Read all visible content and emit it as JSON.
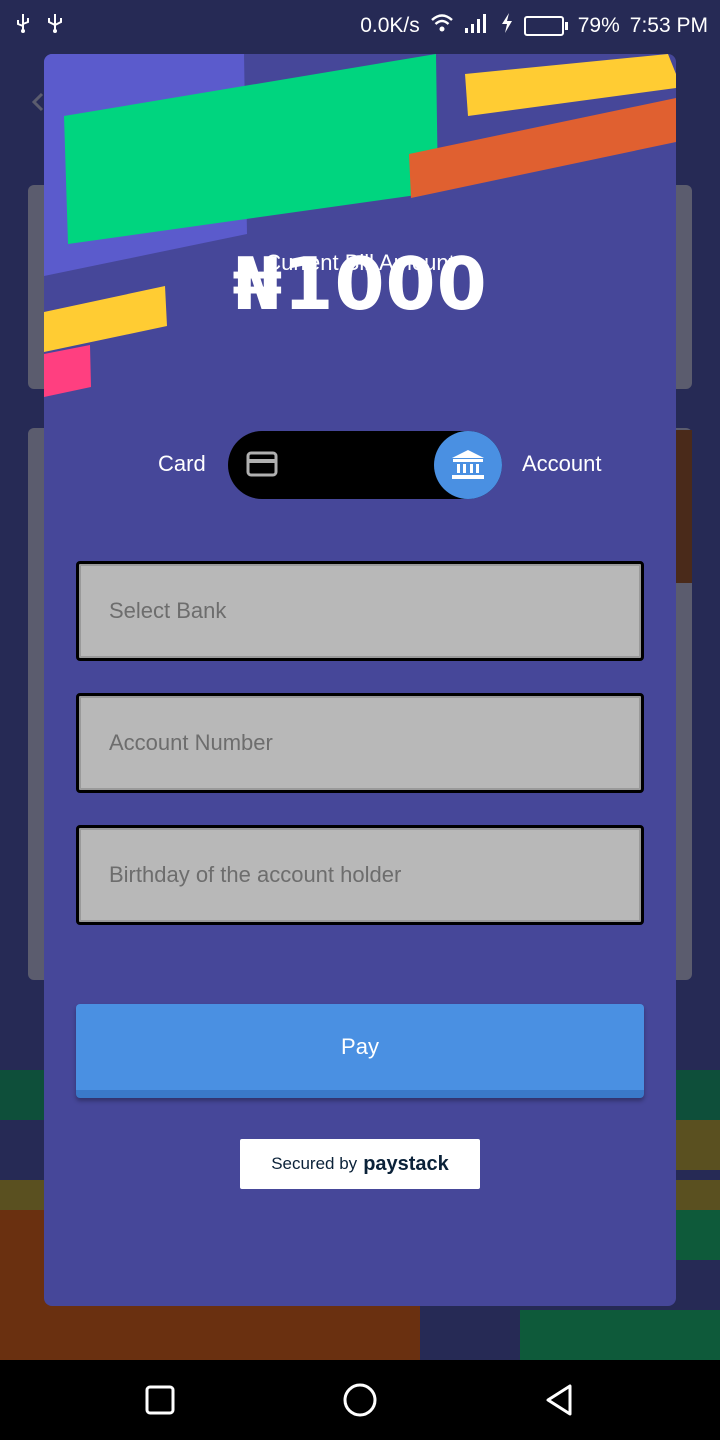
{
  "status_bar": {
    "icons_left": [
      "usb-icon",
      "usb-icon"
    ],
    "network_speed": "0.0K/s",
    "icons_right": [
      "wifi-icon",
      "signal-icon",
      "charging-icon",
      "battery-icon"
    ],
    "battery_percent": "79%",
    "battery_level": 0.79,
    "time": "7:53 PM"
  },
  "payment": {
    "bill_label": "Current Bill Amount",
    "bill_amount": "₦1000",
    "toggle": {
      "left_label": "Card",
      "right_label": "Account",
      "selected": "Account",
      "left_icon": "credit-card-icon",
      "right_icon": "bank-icon"
    },
    "fields": {
      "bank_placeholder": "Select Bank",
      "account_number_placeholder": "Account Number",
      "birthday_placeholder": "Birthday of the account holder"
    },
    "pay_label": "Pay",
    "secured_prefix": "Secured by",
    "secured_brand": "paystack"
  },
  "nav_bar": {
    "buttons": [
      "recents-icon",
      "home-icon",
      "back-icon"
    ]
  },
  "colors": {
    "dialog_background": "#464799",
    "accent_blue": "#4a90e2",
    "green": "#00d57f",
    "yellow": "#ffcc33",
    "orange": "#e06030",
    "pink": "#ff3f80",
    "violet": "#5b5bcc"
  }
}
